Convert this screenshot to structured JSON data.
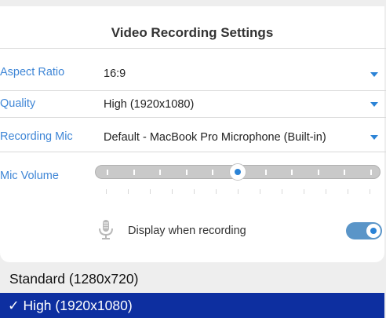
{
  "panel": {
    "title": "Video Recording Settings",
    "rows": [
      {
        "label": "Aspect Ratio",
        "value": "16:9"
      },
      {
        "label": "Quality",
        "value": "High (1920x1080)"
      },
      {
        "label": "Recording Mic",
        "value": "Default - MacBook Pro Microphone (Built-in)"
      }
    ],
    "mic_volume": {
      "label": "Mic Volume",
      "level_fraction": 0.5
    },
    "display_when_recording": {
      "label": "Display when recording",
      "enabled": true
    }
  },
  "dropdown": {
    "options": [
      {
        "label": "Standard (1280x720)",
        "selected": false
      },
      {
        "label": "High (1920x1080)",
        "selected": true,
        "check": "✓"
      }
    ]
  },
  "colors": {
    "accent": "#2b83d6",
    "label_blue": "#3f86d6",
    "selected_bg": "#0d2fa0",
    "toggle_bg": "#5a95c8"
  },
  "icons": {
    "row_caret": "chevron-down-icon",
    "mic": "microphone-icon"
  }
}
